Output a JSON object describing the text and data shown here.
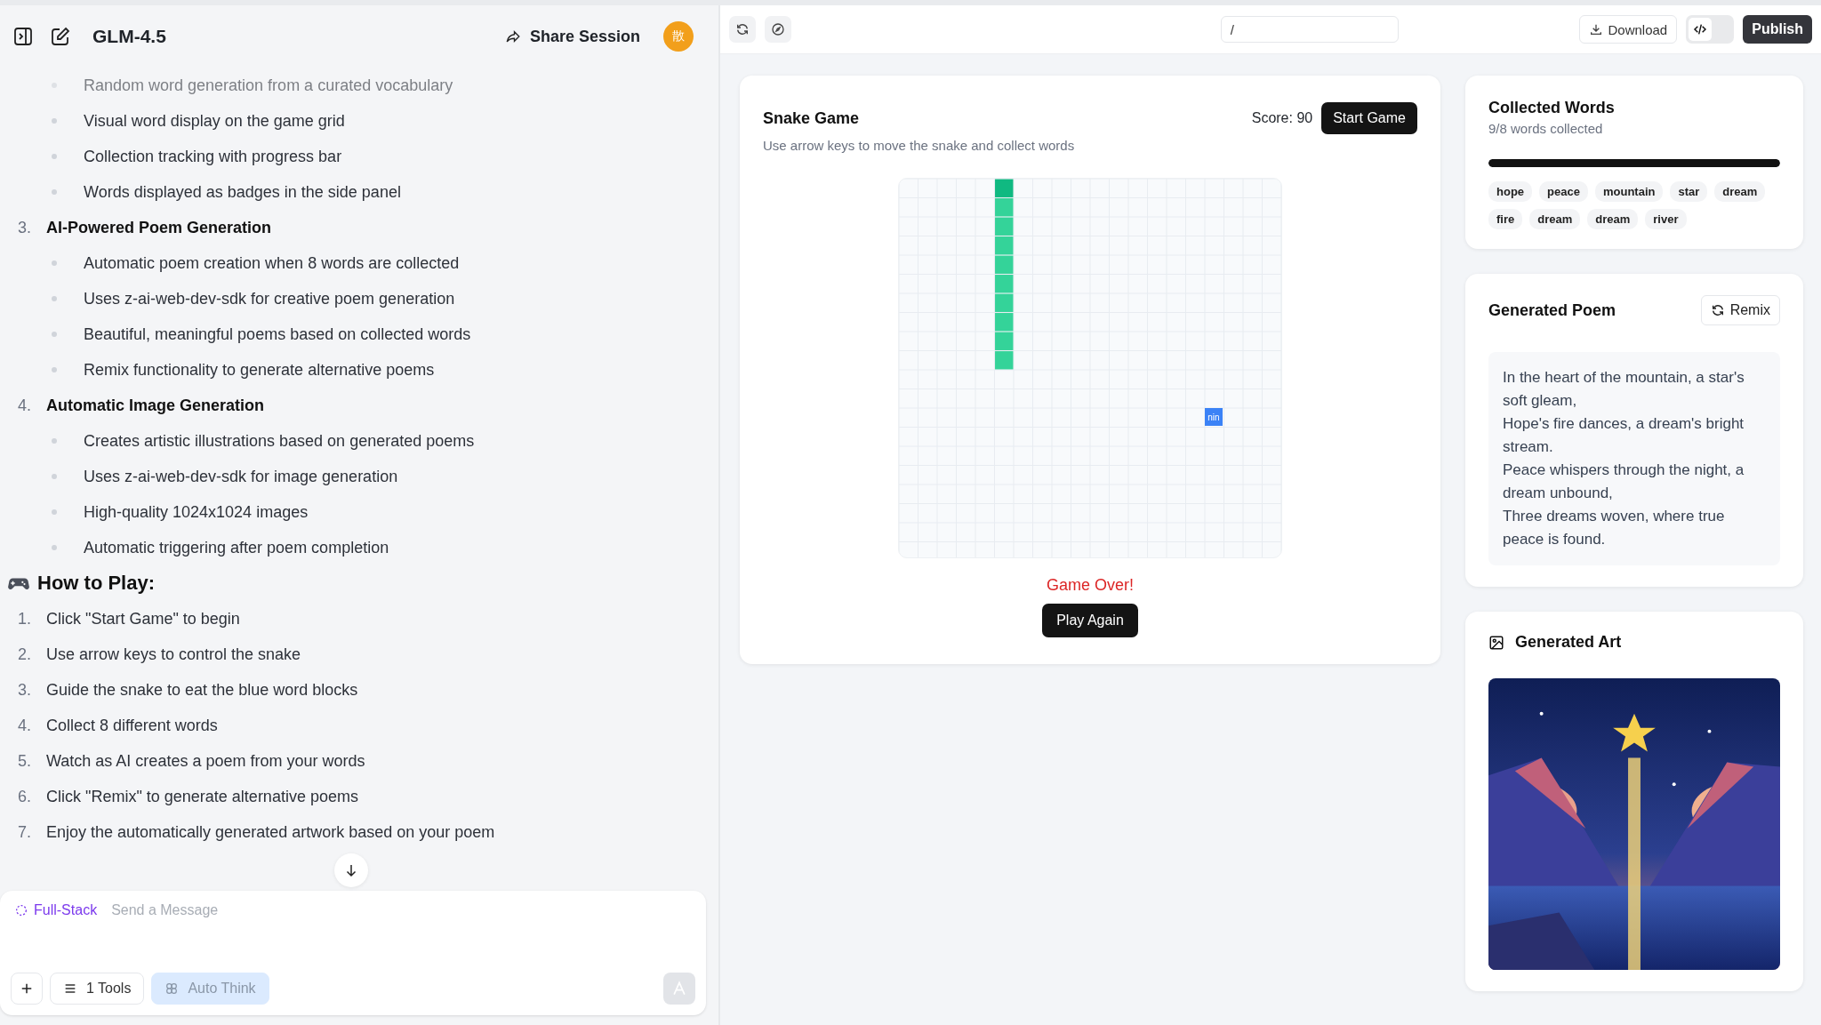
{
  "header": {
    "title": "GLM-4.5",
    "share_label": "Share Session",
    "avatar": "散"
  },
  "chat": {
    "faded_line": "Random word generation from a curated vocabulary",
    "bullets": [
      "Visual word display on the game grid",
      "Collection tracking with progress bar",
      "Words displayed as badges in the side panel"
    ],
    "features": [
      {
        "number": "3.",
        "title": "AI-Powered Poem Generation",
        "bullets": [
          "Automatic poem creation when 8 words are collected",
          "Uses z-ai-web-dev-sdk for creative poem generation",
          "Beautiful, meaningful poems based on collected words",
          "Remix functionality to generate alternative poems"
        ]
      },
      {
        "number": "4.",
        "title": "Automatic Image Generation",
        "bullets": [
          "Creates artistic illustrations based on generated poems",
          "Uses z-ai-web-dev-sdk for image generation",
          "High-quality 1024x1024 images",
          "Automatic triggering after poem completion"
        ]
      }
    ],
    "how_to_play": {
      "heading": "How to Play:",
      "steps": [
        {
          "number": "1.",
          "text": "Click \"Start Game\" to begin"
        },
        {
          "number": "2.",
          "text": "Use arrow keys to control the snake"
        },
        {
          "number": "3.",
          "text": "Guide the snake to eat the blue word blocks"
        },
        {
          "number": "4.",
          "text": "Collect 8 different words"
        },
        {
          "number": "5.",
          "text": "Watch as AI creates a poem from your words"
        },
        {
          "number": "6.",
          "text": "Click \"Remix\" to generate alternative poems"
        },
        {
          "number": "7.",
          "text": "Enjoy the automatically generated artwork based on your poem"
        }
      ]
    }
  },
  "composer": {
    "mode": "Full-Stack",
    "placeholder": "Send a Message",
    "tools_label": "1 Tools",
    "auto_think_label": "Auto Think"
  },
  "toolbar": {
    "url": "/",
    "download_label": "Download",
    "publish_label": "Publish",
    "code_view_selected": true
  },
  "snake_game": {
    "title": "Snake Game",
    "subtitle": "Use arrow keys to move the snake and collect words",
    "score": "Score: 90",
    "start_label": "Start Game",
    "food_word": "nin",
    "status": "Game Over!",
    "play_again_label": "Play Again"
  },
  "collected_words": {
    "title": "Collected Words",
    "subtitle": "9/8 words collected",
    "level": 1,
    "words": [
      "hope",
      "peace",
      "mountain",
      "star",
      "dream",
      "fire",
      "dream",
      "dream",
      "river"
    ]
  },
  "poem": {
    "title": "Generated Poem",
    "remix_label": "Remix",
    "lines": [
      "In the heart of the mountain, a star's soft gleam,",
      "Hope's fire dances, a dream's bright stream.",
      "Peace whispers through the night, a dream unbound,",
      "Three dreams woven, where true peace is found."
    ]
  },
  "art": {
    "title": "Generated Art"
  }
}
